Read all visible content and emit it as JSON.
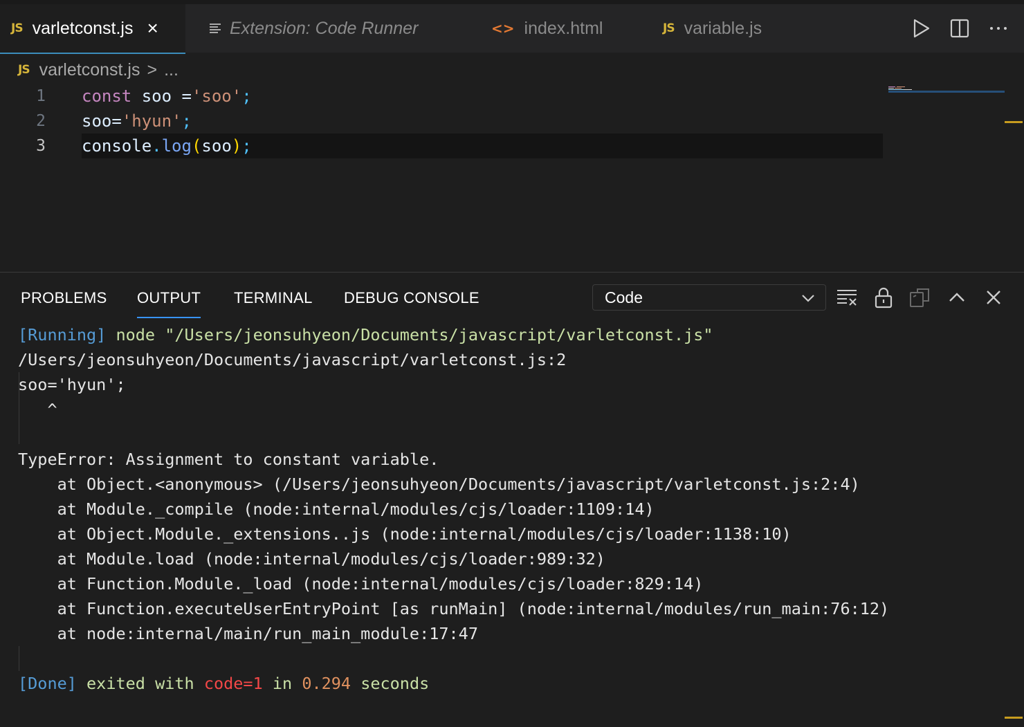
{
  "tabs": [
    {
      "badge": "JS",
      "label": "varletconst.js",
      "close": "×"
    },
    {
      "label": "Extension: Code Runner"
    },
    {
      "badge": "<>",
      "label": "index.html"
    },
    {
      "badge": "JS",
      "label": "variable.js"
    }
  ],
  "breadcrumb": {
    "badge": "JS",
    "file": "varletconst.js",
    "sep": ">",
    "more": "..."
  },
  "editor": {
    "line_numbers": [
      "1",
      "2",
      "3"
    ],
    "lines": [
      {
        "kw": "const",
        "var": " soo ",
        "op": "=",
        "str": "'soo'",
        "semi": ";"
      },
      {
        "var": "soo",
        "op": "=",
        "str": "'hyun'",
        "semi": ";"
      },
      {
        "obj": "console",
        "dot": ".",
        "fn": "log",
        "open": "(",
        "arg": "soo",
        "close": ")",
        "semi": ";"
      }
    ]
  },
  "panel": {
    "tabs": [
      "PROBLEMS",
      "OUTPUT",
      "TERMINAL",
      "DEBUG CONSOLE"
    ],
    "active_tab": "OUTPUT",
    "channel": "Code",
    "output": {
      "running_tag": "[Running]",
      "running_cmd": " node \"/Users/jeonsuhyeon/Documents/javascript/varletconst.js\"",
      "lines": [
        "/Users/jeonsuhyeon/Documents/javascript/varletconst.js:2",
        "soo='hyun';",
        "   ^",
        "",
        "TypeError: Assignment to constant variable.",
        "    at Object.<anonymous> (/Users/jeonsuhyeon/Documents/javascript/varletconst.js:2:4)",
        "    at Module._compile (node:internal/modules/cjs/loader:1109:14)",
        "    at Object.Module._extensions..js (node:internal/modules/cjs/loader:1138:10)",
        "    at Module.load (node:internal/modules/cjs/loader:989:32)",
        "    at Function.Module._load (node:internal/modules/cjs/loader:829:14)",
        "    at Function.executeUserEntryPoint [as runMain] (node:internal/modules/run_main:76:12)",
        "    at node:internal/main/run_main_module:17:47",
        ""
      ],
      "done_tag": "[Done]",
      "done_text1": " exited with ",
      "done_code": "code=1",
      "done_text2": " in ",
      "done_time": "0.294",
      "done_text3": " seconds"
    }
  },
  "icons": {
    "toolbar": [
      "run-icon",
      "split-editor-icon",
      "more-actions-icon"
    ],
    "panel": [
      "clear-output-icon",
      "lock-scroll-icon",
      "open-in-editor-icon",
      "maximize-panel-icon",
      "close-panel-icon"
    ]
  },
  "colors": {
    "accent": "#3794ff",
    "js_badge": "#d6b53a",
    "html_badge": "#e37933"
  }
}
